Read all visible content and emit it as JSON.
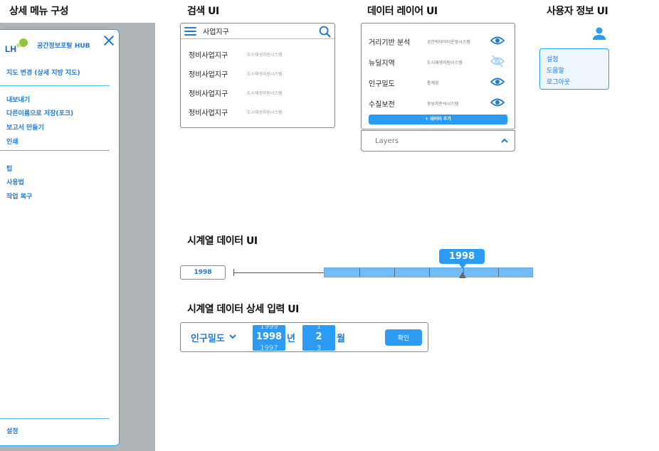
{
  "sections": {
    "detail_menu": "상세 메뉴 구성",
    "search": "검색 UI",
    "data_layer": "데이터 레이어 UI",
    "user_info": "사용자 정보 UI",
    "timeline": "시계열 데이터 UI",
    "timeline_detail": "시계열 데이터 상세 입력 UI"
  },
  "menu": {
    "logo_text": "LH",
    "brand": "공간정보포탈 HUB",
    "group1": [
      "지도 변경 (상세 지방 지도)"
    ],
    "group2": [
      "내보내기",
      "다른이름으로 저장(포크)",
      "보고서 만들기",
      "인쇄"
    ],
    "group3": [
      "팁",
      "사용법",
      "작업 복구"
    ],
    "footer": "설정"
  },
  "search": {
    "query": "사업지구",
    "results": [
      {
        "name": "정비사업지구",
        "source": "도시재생지원시스템"
      },
      {
        "name": "정비사업지구",
        "source": "도시재생지원시스템"
      },
      {
        "name": "정비사업지구",
        "source": "도시재생지원시스템"
      },
      {
        "name": "정비사업지구",
        "source": "도시재생지원시스템"
      }
    ]
  },
  "layers": {
    "items": [
      {
        "name": "거리기반 분석",
        "source": "공간빅데이터운영시스템",
        "visible": true
      },
      {
        "name": "뉴딜지역",
        "source": "도시재생지원시스템",
        "visible": false
      },
      {
        "name": "인구밀도",
        "source": "통계청",
        "visible": true
      },
      {
        "name": "수질보전",
        "source": "후보지분석시스템",
        "visible": true
      }
    ],
    "add_button": "+ 데이터 추가",
    "toggle_label": "Layers"
  },
  "user": {
    "menu": [
      "설정",
      "도움말",
      "로그아웃"
    ]
  },
  "timeline": {
    "year_box": "1998",
    "bubble": "1998",
    "accent": "#2b9bf4"
  },
  "timeline_detail": {
    "layer": "인구밀도",
    "year_prev": "1999",
    "year": "1998",
    "year_next": "1997",
    "year_unit": "년",
    "month_prev": "1",
    "month": "2",
    "month_next": "3",
    "month_unit": "월",
    "confirm": "확인"
  }
}
